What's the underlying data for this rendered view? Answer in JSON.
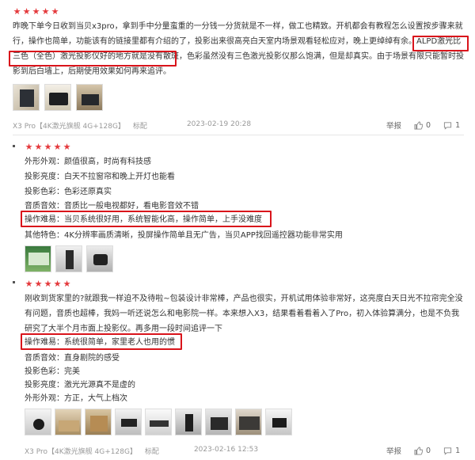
{
  "review1": {
    "rating": 5,
    "text": "昨晚下单今日收到当贝x3pro，拿到手中分量蛮重的一分钱一分货就是不一样，做工也精致。开机都会有教程怎么设置按步骤来就行，操作也简单，功能该有的链接里都有介绍的了，投影出来很高亮白天室内场景观看轻松应对，晚上更绰绰有余。",
    "hl_text_a": "ALPD激光比三",
    "hl_text_b": "色（全色）激光投影仪好的地方就是没有散斑，",
    "text_tail": "色彩虽然没有三色激光投影仪那么饱满，但是却真实。由于场景有限只能暂时投影到后白墙上，后期使用效果如何再来追评。",
    "meta": {
      "product": "X3 Pro【4K激光旗舰 4G+128G】",
      "tag": "标配",
      "date": "2023-02-19 20:28"
    },
    "actions": {
      "report": "举报",
      "likes": "0",
      "comments": "1"
    }
  },
  "review2": {
    "rating": 5,
    "lines": [
      "外形外观：颜值很高，时尚有科技感",
      "投影亮度：白天不拉窗帘和晚上开灯也能看",
      "投影色彩：色彩还原真实",
      "音质音效：音质比一般电视都好，看电影音效不错",
      "操作难易：当贝系统很好用，系统智能化高，操作简单，上手没难度",
      "其他特色：4K分辨率画质清晰，投屏操作简单且无广告，当贝APP找回遥控器功能非常实用"
    ]
  },
  "review3": {
    "rating": 5,
    "text": "刚收到货家里的?就跟我一样迫不及待啦~包装设计非常棒，产品也很实，开机试用体验非常好，这亮度白天日光不拉帘完全没有问题，音质也超棒，我妈一听还说怎么和电影院一样。本来想入X3，结果看着看着入了Pro，初入体验算满分，也是不负我研究了大半个月市面上投影仪。再多用一段时间追评一下",
    "lines": [
      "操作难易：系统很简单，家里老人也用的惯",
      "音质音效：直身剧院的感受",
      "投影色彩：完美",
      "投影亮度：激光光源真不是虚的",
      "外形外观：方正，大气上档次"
    ],
    "meta": {
      "product": "X3 Pro【4K激光旗舰 4G+128G】",
      "tag": "标配",
      "date": "2023-02-16 12:53"
    },
    "actions": {
      "report": "举报",
      "likes": "0",
      "comments": "1"
    }
  },
  "colors": {
    "star": "#e4393c",
    "highlight": "#d9141b",
    "meta": "#999999"
  },
  "icons": {
    "star": "star-icon",
    "like": "thumbs-up-icon",
    "comment": "comment-icon"
  }
}
